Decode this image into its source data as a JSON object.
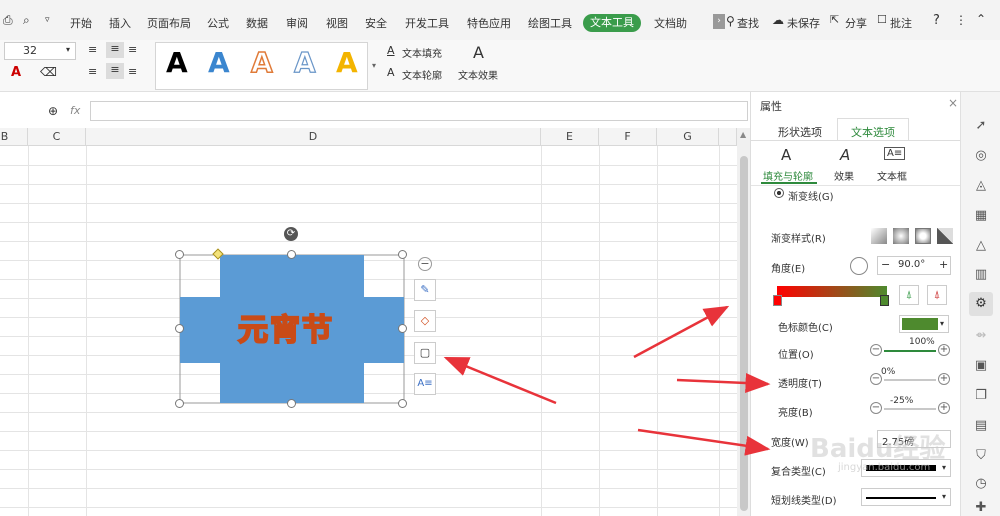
{
  "menu": {
    "items": [
      "开始",
      "插入",
      "页面布局",
      "公式",
      "数据",
      "审阅",
      "视图",
      "安全",
      "开发工具",
      "特色应用",
      "绘图工具",
      "文本工具",
      "文档助"
    ],
    "active": "文本工具",
    "search": "查找",
    "unsaved": "未保存",
    "share": "分享",
    "comment": "批注",
    "help": "?"
  },
  "ribbon": {
    "font_size": "32",
    "text_fill": "文本填充",
    "text_outline": "文本轮廓",
    "text_effect": "文本效果"
  },
  "formula": {
    "fx": "fx"
  },
  "sheet": {
    "columns": [
      "B",
      "C",
      "D",
      "E",
      "F",
      "G"
    ]
  },
  "shape": {
    "text": "元宵节",
    "fill": "#5b9bd5"
  },
  "panel": {
    "title": "属性",
    "tabs": [
      "形状选项",
      "文本选项"
    ],
    "active_tab": "文本选项",
    "subtabs": [
      "填充与轮廓",
      "效果",
      "文本框"
    ],
    "gradient_line": "渐变线(G)",
    "gradient_style": "渐变样式(R)",
    "angle_label": "角度(E)",
    "angle_value": "90.0°",
    "stop_color": "色标颜色(C)",
    "position_label": "位置(O)",
    "position_value": "100%",
    "transparency_label": "透明度(T)",
    "transparency_value": "0%",
    "brightness_label": "亮度(B)",
    "brightness_value": "-25%",
    "width_label": "宽度(W)",
    "width_value": "2.75磅",
    "compound_label": "复合类型(C)",
    "dash_label": "短划线类型(D)"
  },
  "colors": {
    "accent": "#3a9c4b",
    "stop_color": "#4e8a2e",
    "arrow": "#e8333a"
  },
  "watermark": {
    "text": "Baidu经验",
    "url": "jingyan.baidu.com"
  }
}
